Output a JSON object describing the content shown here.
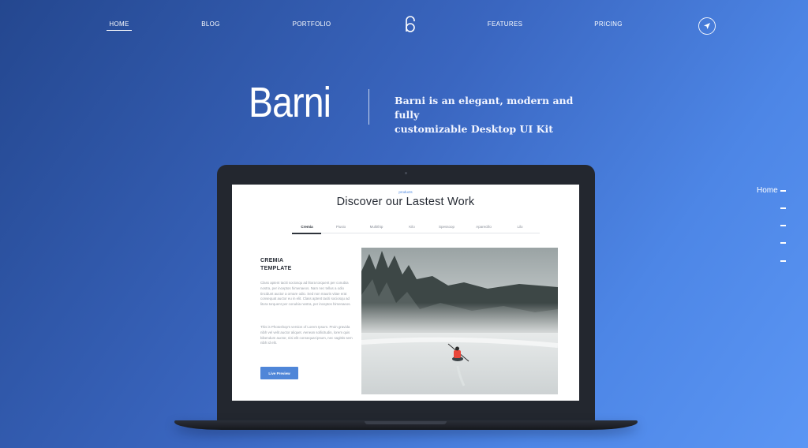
{
  "nav": {
    "items": [
      {
        "label": "HOME",
        "active": true
      },
      {
        "label": "BLOG"
      },
      {
        "label": "PORTFOLIO"
      },
      {
        "label": "FEATURES"
      },
      {
        "label": "PRICING"
      }
    ],
    "logo_icon": "barni-logo-icon",
    "action_icon": "send-arrow-icon"
  },
  "hero": {
    "title": "Barni",
    "tagline_line1": "Barni is an elegant, modern and fully",
    "tagline_line2": "customizable Desktop UI Kit"
  },
  "side_nav": {
    "active_label": "Home",
    "dash_count": 5
  },
  "laptop": {
    "screen": {
      "eyebrow": "products",
      "title": "Discover our Lastest Work",
      "tabs": [
        "Cremia",
        "Piusio",
        "Multithip",
        "Kilo",
        "Spessoop",
        "Aparecillo",
        "Lilo"
      ],
      "active_tab": "Cremia",
      "heading_line1": "CREMIA",
      "heading_line2": "TEMPLATE",
      "paragraph1": "Class aptent taciti sociosqu ad litora torquent per conubia nostra, per inceptos himenaeos. Nam nec tellus a odio tincidunt auctor a ornare odio. Sed non mauris vitae erat consequat auctor eu in elit. Class aptent taciti sociosqu ad litora torquent per conubia nostra, per inceptos himenaeos.",
      "paragraph2": "This is Photoshop's version of Lorem Ipsum. Proin gravida nibh vel velit auctor aliquet. Aenean sollicitudin, lorem quis bibendum auctor, nisi elit consequat ipsum, nec sagittis sem nibh id elit.",
      "button_label": "Live Preview",
      "photo_subject": "kayaker on misty lake"
    }
  },
  "colors": {
    "bg_start": "#24478f",
    "bg_end": "#5b96f4",
    "accent": "#4f86d8",
    "laptop": "#23272f",
    "kayak_red": "#e8463a"
  }
}
